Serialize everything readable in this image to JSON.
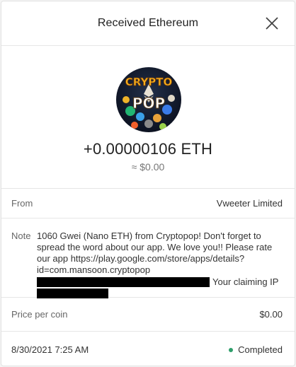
{
  "header": {
    "title": "Received Ethereum"
  },
  "icons": {
    "close": "close-icon",
    "avatar": "cryptopop-app-logo"
  },
  "hero": {
    "logo_word1": "CRYPTO",
    "logo_word2": "POP",
    "amount": "+0.00000106 ETH",
    "fiat": "≈ $0.00"
  },
  "details": {
    "from_label": "From",
    "from_value": "Vweeter Limited",
    "note_label": "Note",
    "note_text": "1060 Gwei (Nano ETH) from Cryptopop! Don't forget to spread the word about our app. We love you!! Please rate our app https://play.google.com/store/apps/details?id=com.mansoon.cryptopop",
    "note_tail": "Your claiming IP",
    "price_label": "Price per coin",
    "price_value": "$0.00"
  },
  "footer": {
    "date": "8/30/2021 7:25 AM",
    "status": "Completed",
    "status_color": "#2e9e6a"
  }
}
